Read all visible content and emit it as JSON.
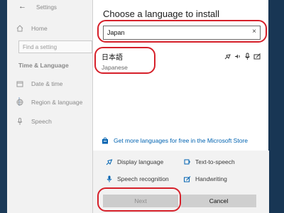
{
  "settings_window": {
    "title": "Settings",
    "back_glyph": "←",
    "search_placeholder": "Find a setting",
    "section_heading": "Time & Language",
    "nav": [
      {
        "label": "Home",
        "icon": "home-icon"
      },
      {
        "label": "Date & time",
        "icon": "calendar-icon"
      },
      {
        "label": "Region & language",
        "icon": "globe-icon"
      },
      {
        "label": "Speech",
        "icon": "microphone-icon"
      }
    ]
  },
  "dialog": {
    "title": "Choose a language to install",
    "search": {
      "value": "Japan",
      "clear_glyph": "×"
    },
    "result": {
      "native_name": "日本語",
      "english_name": "Japanese",
      "feature_icons": [
        "display-language-icon",
        "text-to-speech-icon",
        "speech-recognition-icon",
        "handwriting-icon"
      ]
    },
    "store_link": "Get more languages for free in the Microsoft Store",
    "features": [
      {
        "label": "Display language",
        "icon": "display-language-icon"
      },
      {
        "label": "Text-to-speech",
        "icon": "text-to-speech-icon"
      },
      {
        "label": "Speech recognition",
        "icon": "microphone-icon"
      },
      {
        "label": "Handwriting",
        "icon": "handwriting-icon"
      }
    ],
    "buttons": {
      "next": "Next",
      "cancel": "Cancel"
    }
  },
  "colors": {
    "accent": "#0063b1",
    "annotation": "#d6202a",
    "desktop": "#1f3d5c"
  }
}
